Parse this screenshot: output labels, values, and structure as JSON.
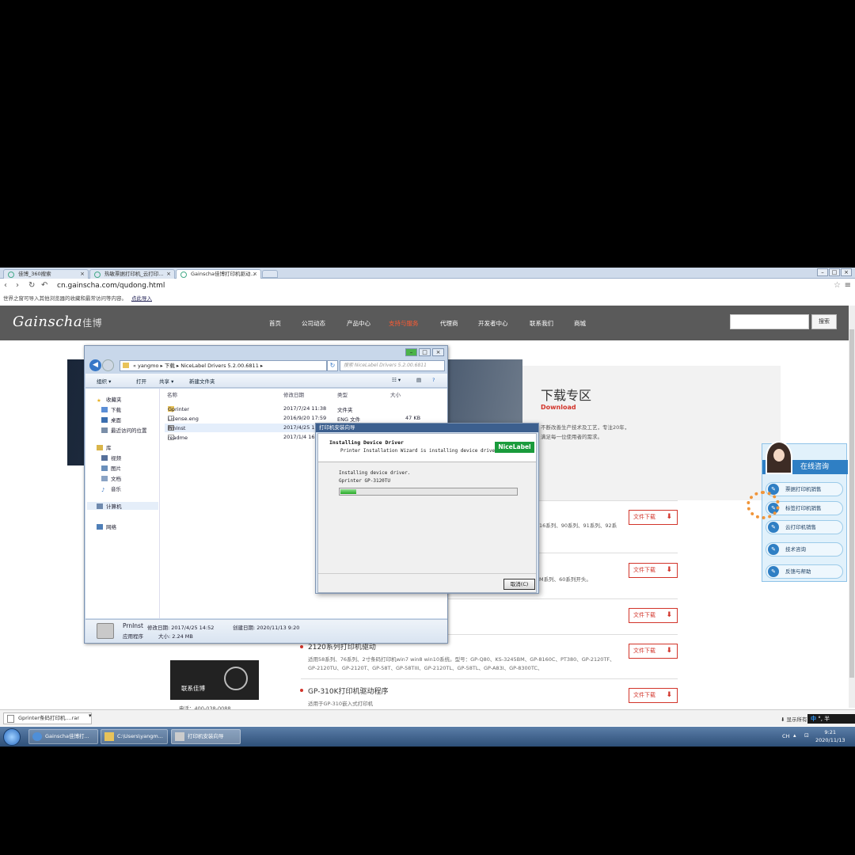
{
  "browser": {
    "tabs": [
      {
        "label": "佳博_360搜索"
      },
      {
        "label": "热敏票据打印机_云打印..."
      },
      {
        "label": "Gainscha佳博打印机驱动..."
      }
    ],
    "url": "cn.gainscha.com/qudong.html",
    "infobar_text": "世界之窗可导入其他浏览器的收藏和最常访问等内容。",
    "infobar_link": "点此导入"
  },
  "site": {
    "logo": "Gainscha",
    "logo_cn": "佳博",
    "nav": [
      "首页",
      "公司动态",
      "产品中心",
      "支持与服务",
      "代理商",
      "开发者中心",
      "联系我们",
      "商城"
    ],
    "search_button": "搜索",
    "download_title": "下载专区",
    "download_sub": "Download",
    "download_desc_1": "不断改善生产技术及工艺，专注20年，",
    "download_desc_2": "满足每一位使用者的需求。",
    "download_button": "文件下载",
    "row1_frag": "16系列、90系列、91系列、92系",
    "row2_frag": "M系列、60系列开头。",
    "row4_title": "2120系列打印机驱动",
    "row4_text1": "适用58系列、76系列、2寸条码打印机win7 win8 win10系统。型号：GP-Q80、KS-3245BM、GP-8160C、PT380、GP-2120TF、",
    "row4_text2": "GP-2120TU、GP-2120T、GP-58T、GP-58TIII、GP-2120TL、GP-58TL、GP-A83I、GP-8300TC、",
    "row5_title": "GP-310K打印机驱动程序",
    "row5_text": "适用于GP-310嵌入式打印机",
    "contact_label": "联系佳博",
    "tel": "电话：400-038-0088",
    "consult_title": "在线咨询",
    "consult_items": [
      "票据打印机销售",
      "标签打印机销售",
      "云打印机销售",
      "技术咨询",
      "反馈与帮助"
    ]
  },
  "explorer": {
    "path": [
      "yangmo",
      "下载",
      "NiceLabel Drivers 5.2.00.6811"
    ],
    "search_placeholder": "搜索 NiceLabel Drivers 5.2.00.6811",
    "toolbar": [
      "组织 ▾",
      "打开",
      "共享 ▾",
      "新建文件夹"
    ],
    "nav": [
      "收藏夹",
      "下载",
      "桌面",
      "最近访问的位置",
      "库",
      "视频",
      "图片",
      "文档",
      "音乐",
      "计算机",
      "网络"
    ],
    "columns": [
      "名称",
      "修改日期",
      "类型",
      "大小"
    ],
    "files": [
      {
        "name": "Gprinter",
        "date": "2017/7/24 11:38",
        "type": "文件夹",
        "size": ""
      },
      {
        "name": "License.eng",
        "date": "2016/9/20 17:59",
        "type": "ENG 文件",
        "size": "47 KB"
      },
      {
        "name": "PrnInst",
        "date": "2017/4/25 1",
        "type": "",
        "size": ""
      },
      {
        "name": "readme",
        "date": "2017/1/4 16",
        "type": "",
        "size": ""
      }
    ],
    "details": {
      "name": "PrnInst",
      "modified": "修改日期: 2017/4/25 14:52",
      "created": "创建日期: 2020/11/13 9:20",
      "kind": "应用程序",
      "size": "大小: 2.24 MB"
    }
  },
  "wizard": {
    "title": "打印机安装向导",
    "heading": "Installing Device Driver",
    "subheading": "Printer Installation Wizard is installing device driver.",
    "logo": "NiceLabel",
    "status_line1": "Installing device driver.",
    "status_line2": "Gprinter GP-3120TU",
    "progress": 0.09,
    "cancel": "取消(C)"
  },
  "downloads": {
    "item": "Gprinter条码打印机....rar",
    "show_all": "显示所有下载内容..."
  },
  "ime": {
    "lang": "中",
    "mode": "°, 半"
  },
  "taskbar": {
    "tasks": [
      "Gainscha佳博打...",
      "C:\\Users\\yangm...",
      "打印机安装向导"
    ],
    "lang": "CH",
    "time": "9:21",
    "date": "2020/11/13"
  },
  "colors": {
    "accent": "#d2342a",
    "nicelabel": "#1a9b3c",
    "consult": "#2f7fc4"
  }
}
